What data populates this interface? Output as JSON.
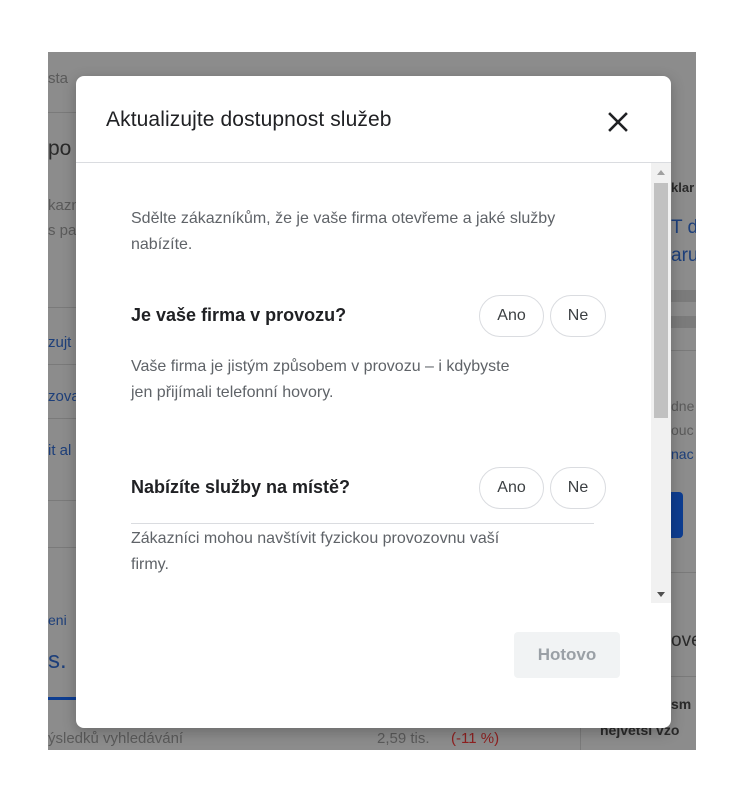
{
  "background": {
    "top_fragment": "sta",
    "heading_fragment": "po",
    "left_fragments": [
      "kazn",
      "s pa",
      "zujt",
      "zova",
      "it al",
      "eni"
    ],
    "big_fragment": "s.",
    "right_fragments": [
      "klar",
      "T d",
      "aru",
      "dne",
      "ouc",
      "nac",
      "ove",
      "sm",
      "nejvetsi vzo"
    ],
    "footer_left": "ýsledků vyhledávání",
    "footer_value": "2,59 tis.",
    "footer_change": "(-11 %)"
  },
  "modal": {
    "title": "Aktualizujte dostupnost služeb",
    "close_icon": "close-icon",
    "intro": "Sdělte zákazníkům, že je vaše firma otevřeme a jaké služby nabízíte.",
    "questions": [
      {
        "question": "Je vaše firma v provozu?",
        "yes_label": "Ano",
        "no_label": "Ne",
        "description": "Vaše firma je jistým způsobem v provozu – i kdybyste jen přijímali telefonní hovory."
      },
      {
        "question": "Nabízíte služby na místě?",
        "yes_label": "Ano",
        "no_label": "Ne",
        "description": "Zákazníci mohou navštívit fyzickou provozovnu vaší firmy."
      }
    ],
    "done_label": "Hotovo"
  },
  "colors": {
    "title": "#202124",
    "secondary_text": "#5f6368",
    "border": "#dadce0",
    "disabled_button_bg": "#f1f3f4",
    "disabled_button_text": "#9aa0a6",
    "background_overlay": "#8c8c8c"
  }
}
